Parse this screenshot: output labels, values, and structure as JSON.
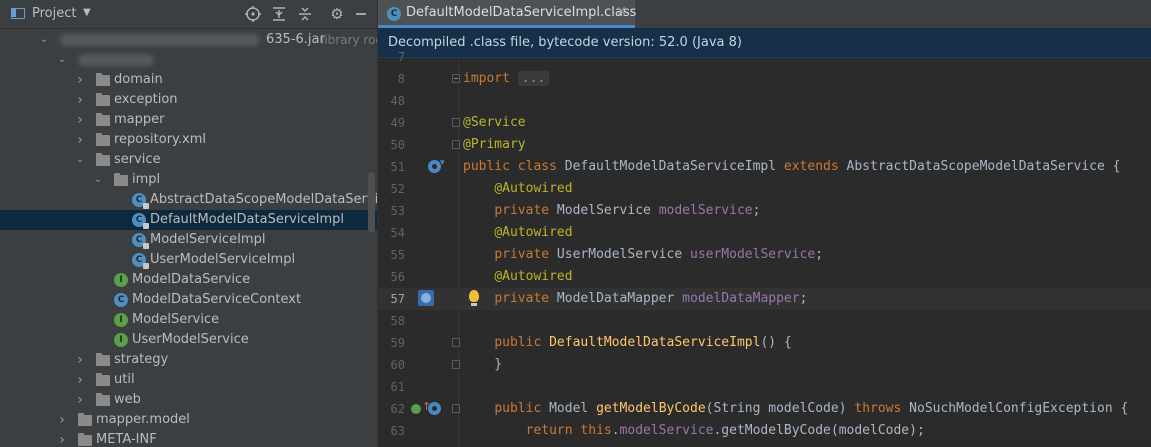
{
  "project_panel": {
    "title": "Project",
    "tree": [
      {
        "label": "635-6.jar",
        "suffix": "library roo",
        "indent": 42,
        "type": "jar",
        "expanded": true,
        "blurred": true
      },
      {
        "label": "",
        "indent": 60,
        "type": "package",
        "expanded": true,
        "blurred": true
      },
      {
        "label": "domain",
        "indent": 78,
        "type": "folder",
        "expanded": false
      },
      {
        "label": "exception",
        "indent": 78,
        "type": "folder",
        "expanded": false
      },
      {
        "label": "mapper",
        "indent": 78,
        "type": "folder",
        "expanded": false
      },
      {
        "label": "repository.xml",
        "indent": 78,
        "type": "folder",
        "expanded": false
      },
      {
        "label": "service",
        "indent": 78,
        "type": "folder",
        "expanded": true
      },
      {
        "label": "impl",
        "indent": 96,
        "type": "folder",
        "expanded": true
      },
      {
        "label": "AbstractDataScopeModelDataService",
        "indent": 114,
        "type": "class"
      },
      {
        "label": "DefaultModelDataServiceImpl",
        "indent": 114,
        "type": "class",
        "selected": true
      },
      {
        "label": "ModelServiceImpl",
        "indent": 114,
        "type": "class"
      },
      {
        "label": "UserModelServiceImpl",
        "indent": 114,
        "type": "class"
      },
      {
        "label": "ModelDataService",
        "indent": 96,
        "type": "interface"
      },
      {
        "label": "ModelDataServiceContext",
        "indent": 96,
        "type": "class-plain"
      },
      {
        "label": "ModelService",
        "indent": 96,
        "type": "interface"
      },
      {
        "label": "UserModelService",
        "indent": 96,
        "type": "interface"
      },
      {
        "label": "strategy",
        "indent": 78,
        "type": "folder",
        "expanded": false
      },
      {
        "label": "util",
        "indent": 78,
        "type": "folder",
        "expanded": false
      },
      {
        "label": "web",
        "indent": 78,
        "type": "folder",
        "expanded": false
      },
      {
        "label": "mapper.model",
        "indent": 60,
        "type": "folder",
        "expanded": false
      },
      {
        "label": "META-INF",
        "indent": 60,
        "type": "folder",
        "expanded": false
      }
    ]
  },
  "editor": {
    "tab_label": "DefaultModelDataServiceImpl.class",
    "tab_close": "×",
    "banner": "Decompiled .class file, bytecode version: 52.0 (Java 8)",
    "lines": [
      {
        "n": "7",
        "html": ""
      },
      {
        "n": "8",
        "fold": "plus",
        "html": "<span class=\"kw\">import</span> <span class=\"folded\">...</span>"
      },
      {
        "n": "48",
        "html": ""
      },
      {
        "n": "49",
        "fold": "box",
        "html": "<span class=\"ann\">@Service</span>"
      },
      {
        "n": "50",
        "fold": "box",
        "html": "<span class=\"ann\">@Primary</span>"
      },
      {
        "n": "51",
        "gutter": "impl",
        "html": "<span class=\"kw\">public class</span> DefaultModelDataServiceImpl <span class=\"kw\">extends</span> AbstractDataScopeModelDataService {"
      },
      {
        "n": "52",
        "html": "    <span class=\"ann\">@Autowired</span>"
      },
      {
        "n": "53",
        "html": "    <span class=\"kw\">private</span> ModelService <span class=\"fld\">modelService</span>;"
      },
      {
        "n": "54",
        "html": "    <span class=\"ann\">@Autowired</span>"
      },
      {
        "n": "55",
        "html": "    <span class=\"kw\">private</span> UserModelService <span class=\"fld\">userModelService</span>;"
      },
      {
        "n": "56",
        "html": "    <span class=\"ann\">@Autowired</span>"
      },
      {
        "n": "57",
        "gutter": "bean",
        "current": true,
        "bulb": true,
        "html": "    <span class=\"kw\">private</span> ModelDataMapper <span class=\"fld\">modelDataMapper</span>;"
      },
      {
        "n": "58",
        "html": ""
      },
      {
        "n": "59",
        "fold": "box",
        "html": "    <span class=\"kw\">public</span> <span class=\"fn\">DefaultModelDataServiceImpl</span>() {"
      },
      {
        "n": "60",
        "fold": "box",
        "html": "    }"
      },
      {
        "n": "61",
        "html": ""
      },
      {
        "n": "62",
        "gutter": "override",
        "fold": "box",
        "html": "    <span class=\"kw\">public</span> Model <span class=\"fn\">getModelByCode</span>(String modelCode) <span class=\"kw\">throws</span> NoSuchModelConfigException {"
      },
      {
        "n": "63",
        "html": "        <span class=\"kw\">return this</span>.<span class=\"fld\">modelService</span>.getModelByCode(modelCode);"
      }
    ]
  },
  "colors": {
    "accent": "#4a88c7",
    "selection": "#0d293e",
    "banner": "#163049"
  }
}
